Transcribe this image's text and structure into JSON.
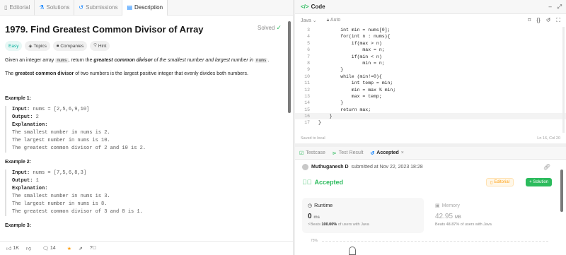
{
  "left_tabs": [
    {
      "label": "Editorial",
      "icon": "book-icon"
    },
    {
      "label": "Solutions",
      "icon": "flask-icon"
    },
    {
      "label": "Submissions",
      "icon": "history-icon"
    },
    {
      "label": "Description",
      "icon": "document-icon"
    }
  ],
  "problem": {
    "title": "1979. Find Greatest Common Divisor of Array",
    "solved_label": "Solved",
    "difficulty": "Easy",
    "tags": [
      "Topics",
      "Companies",
      "Hint"
    ],
    "para1_a": "Given an integer array ",
    "para1_code1": "nums",
    "para1_b": ", return the ",
    "para1_bold": "greatest common divisor",
    "para1_c": " of the smallest number and largest number in ",
    "para1_code2": "nums",
    "para1_d": ".",
    "para2_bold": "greatest common divisor",
    "para2_a": "The ",
    "para2_b": " of two numbers is the largest positive integer that evenly divides both numbers.",
    "examples": [
      {
        "title": "Example 1:",
        "input_label": "Input:",
        "input": " nums = [2,5,6,9,10]",
        "output_label": "Output:",
        "output": " 2",
        "expl_label": "Explanation:",
        "lines": [
          "The smallest number in nums is 2.",
          "The largest number in nums is 10.",
          "The greatest common divisor of 2 and 10 is 2."
        ]
      },
      {
        "title": "Example 2:",
        "input_label": "Input:",
        "input": " nums = [7,5,6,8,3]",
        "output_label": "Output:",
        "output": " 1",
        "expl_label": "Explanation:",
        "lines": [
          "The smallest number in nums is 3.",
          "The largest number in nums is 8.",
          "The greatest common divisor of 3 and 8 is 1."
        ]
      },
      {
        "title": "Example 3:"
      }
    ]
  },
  "bottom": {
    "likes": "1K",
    "comments": "14"
  },
  "code": {
    "tab_label": "Code",
    "language": "Java",
    "mode": "Auto",
    "saved": "Saved to local",
    "cursor": "Ln 16, Col 20",
    "lines": [
      {
        "n": "3",
        "t": "        int min = nums[0];"
      },
      {
        "n": "4",
        "t": "        for(int n : nums){"
      },
      {
        "n": "5",
        "t": "            if(max > n)"
      },
      {
        "n": "6",
        "t": "                max = n;"
      },
      {
        "n": "7",
        "t": "            if(min < n)"
      },
      {
        "n": "8",
        "t": "                min = n;"
      },
      {
        "n": "9",
        "t": "        }"
      },
      {
        "n": "10",
        "t": "        while (min!=0){"
      },
      {
        "n": "11",
        "t": "            int temp = min;"
      },
      {
        "n": "12",
        "t": "            min = max % min;"
      },
      {
        "n": "13",
        "t": "            max = temp;"
      },
      {
        "n": "14",
        "t": "        }"
      },
      {
        "n": "15",
        "t": "        return max;"
      },
      {
        "n": "16",
        "t": "    }"
      },
      {
        "n": "17",
        "t": "}"
      }
    ]
  },
  "result": {
    "tabs": [
      "Testcase",
      "Test Result",
      "Accepted"
    ],
    "submitter": "Muthuganesh D",
    "submitted_text": "submitted at Nov 22, 2023 18:28",
    "status": "Accepted",
    "editorial_btn": "Editorial",
    "solution_btn": "+ Solution",
    "runtime_label": "Runtime",
    "runtime_value": "0",
    "runtime_unit": "ms",
    "runtime_beats_a": "Beats ",
    "runtime_beats_pct": "100.00%",
    "runtime_beats_b": " of users with Java",
    "memory_label": "Memory",
    "memory_value": "42.95",
    "memory_unit": "MB",
    "memory_beats_a": "Beats ",
    "memory_beats_pct": "48.87%",
    "memory_beats_b": " of users with Java",
    "pct_axis": "75%"
  }
}
